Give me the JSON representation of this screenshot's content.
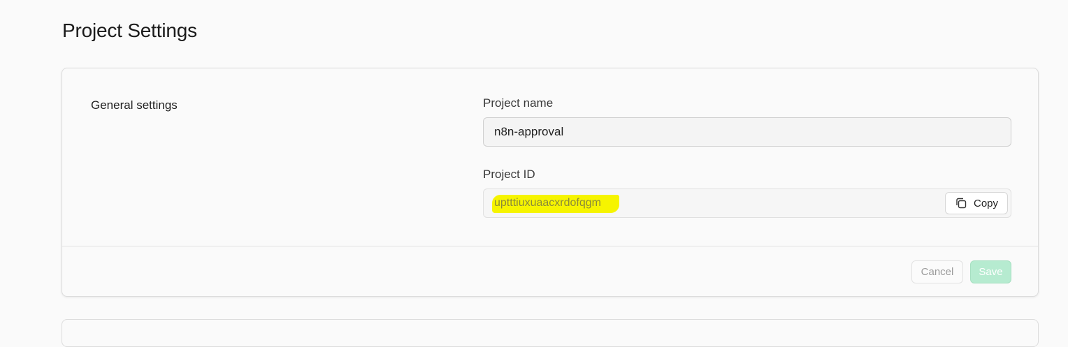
{
  "page": {
    "title": "Project Settings"
  },
  "general": {
    "section_label": "General settings",
    "project_name_label": "Project name",
    "project_name_value": "n8n-approval",
    "project_id_label": "Project ID",
    "project_id_value": "uptttiuxuaacxrdofqgm",
    "copy_label": "Copy",
    "copy_icon": "copy-icon"
  },
  "footer": {
    "cancel_label": "Cancel",
    "save_label": "Save"
  },
  "colors": {
    "highlight": "#f6f400",
    "save_button": "#b6ebd0"
  }
}
